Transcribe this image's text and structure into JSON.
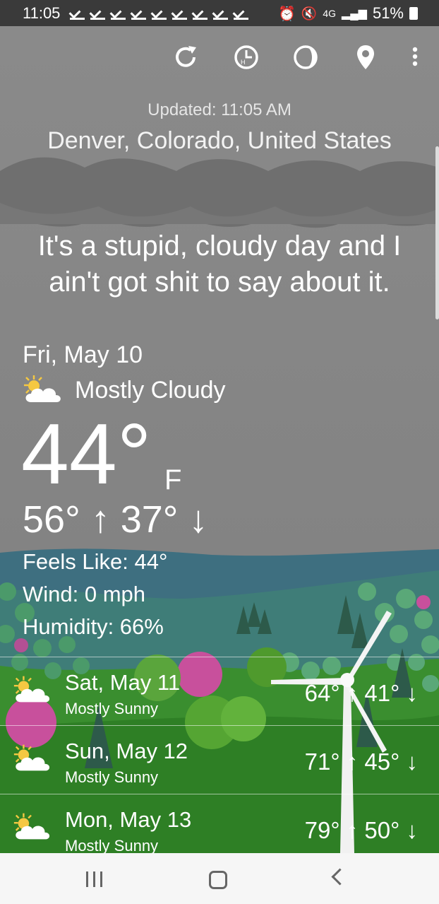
{
  "status_bar": {
    "time": "11:05",
    "network": "4G",
    "battery": "51%"
  },
  "toolbar": {
    "icons": [
      "refresh-icon",
      "history-icon",
      "theme-icon",
      "location-pin-icon",
      "more-vert-icon"
    ]
  },
  "header": {
    "updated": "Updated: 11:05 AM",
    "location": "Denver, Colorado, United States"
  },
  "quip": {
    "line1": "It's a stupid, cloudy day and I",
    "line2": "ain't got shit to say about it."
  },
  "current": {
    "date": "Fri, May 10",
    "condition": "Mostly Cloudy",
    "temperature": "44°",
    "unit": "F",
    "high": "56°",
    "low": "37°",
    "feels_like": "Feels Like: 44°",
    "wind": "Wind: 0 mph",
    "humidity": "Humidity: 66%"
  },
  "forecast": [
    {
      "day": "Sat, May 11",
      "desc": "Mostly Sunny",
      "high": "64°",
      "low": "41°"
    },
    {
      "day": "Sun, May 12",
      "desc": "Mostly Sunny",
      "high": "71°",
      "low": "45°"
    },
    {
      "day": "Mon, May 13",
      "desc": "Mostly Sunny",
      "high": "79°",
      "low": "50°"
    }
  ],
  "colors": {
    "sky": "#868686",
    "hills": "#2f8a2f",
    "accent_pink": "#c8509c"
  }
}
